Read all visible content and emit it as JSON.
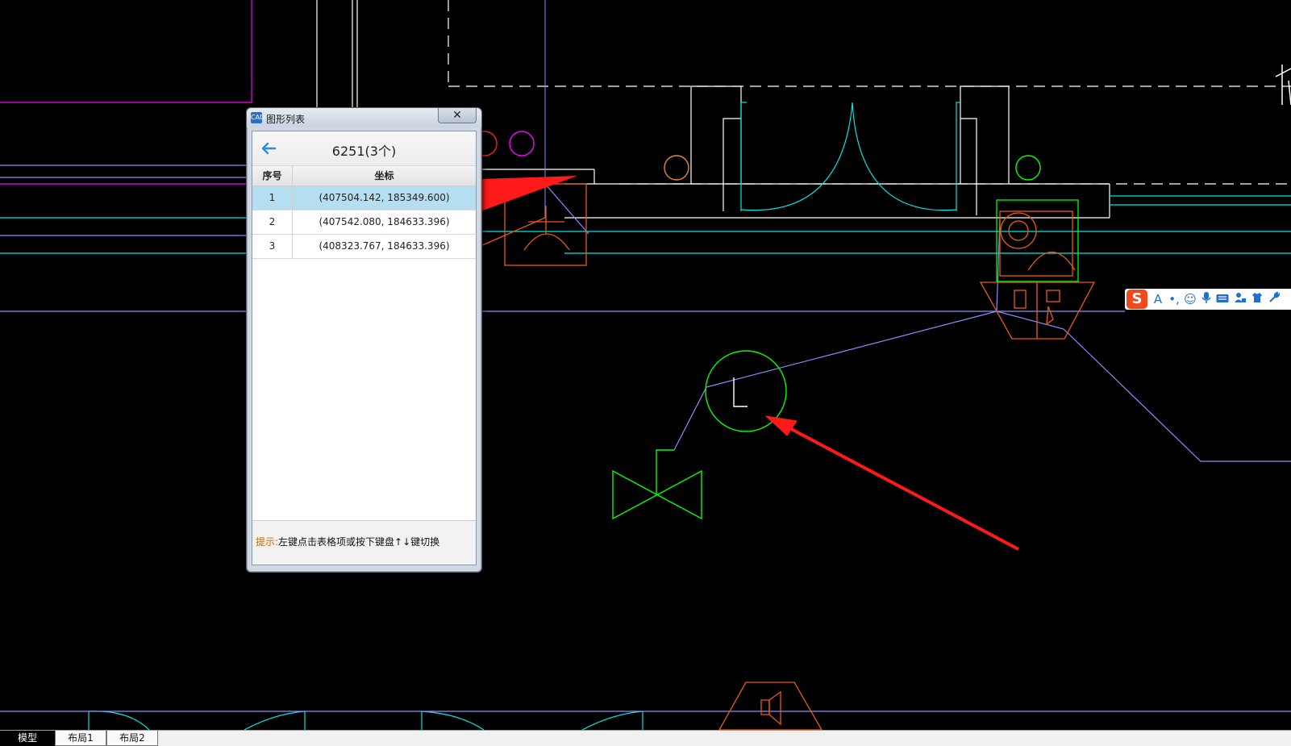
{
  "dialog": {
    "title": "图形列表",
    "app_icon_text": "CAD",
    "close_label": "✕",
    "heading": "6251(3个)",
    "columns": [
      "序号",
      "坐标"
    ],
    "rows": [
      {
        "index": "1",
        "coord": "(407504.142, 185349.600)"
      },
      {
        "index": "2",
        "coord": "(407542.080, 184633.396)"
      },
      {
        "index": "3",
        "coord": "(408323.767, 184633.396)"
      }
    ],
    "selected_row": 1,
    "hint_label": "提示:",
    "hint_text": "左键点击表格项或按下键盘↑↓键切换"
  },
  "tabs": [
    "模型",
    "布局1",
    "布局2"
  ],
  "active_tab": "模型",
  "ime": {
    "logo": "S",
    "buttons": [
      "A",
      "•,",
      "☺",
      "mic",
      "keyboard",
      "user",
      "shirt",
      "wrench"
    ]
  },
  "colors": {
    "background": "#000000",
    "cyan": "#00e5e5",
    "green": "#00ff00",
    "orange": "#e85a1a",
    "magenta": "#ff00ff",
    "blue_line": "#8c8cff",
    "arrow_red": "#ff1a1a",
    "selected_row": "#b5dff0"
  }
}
